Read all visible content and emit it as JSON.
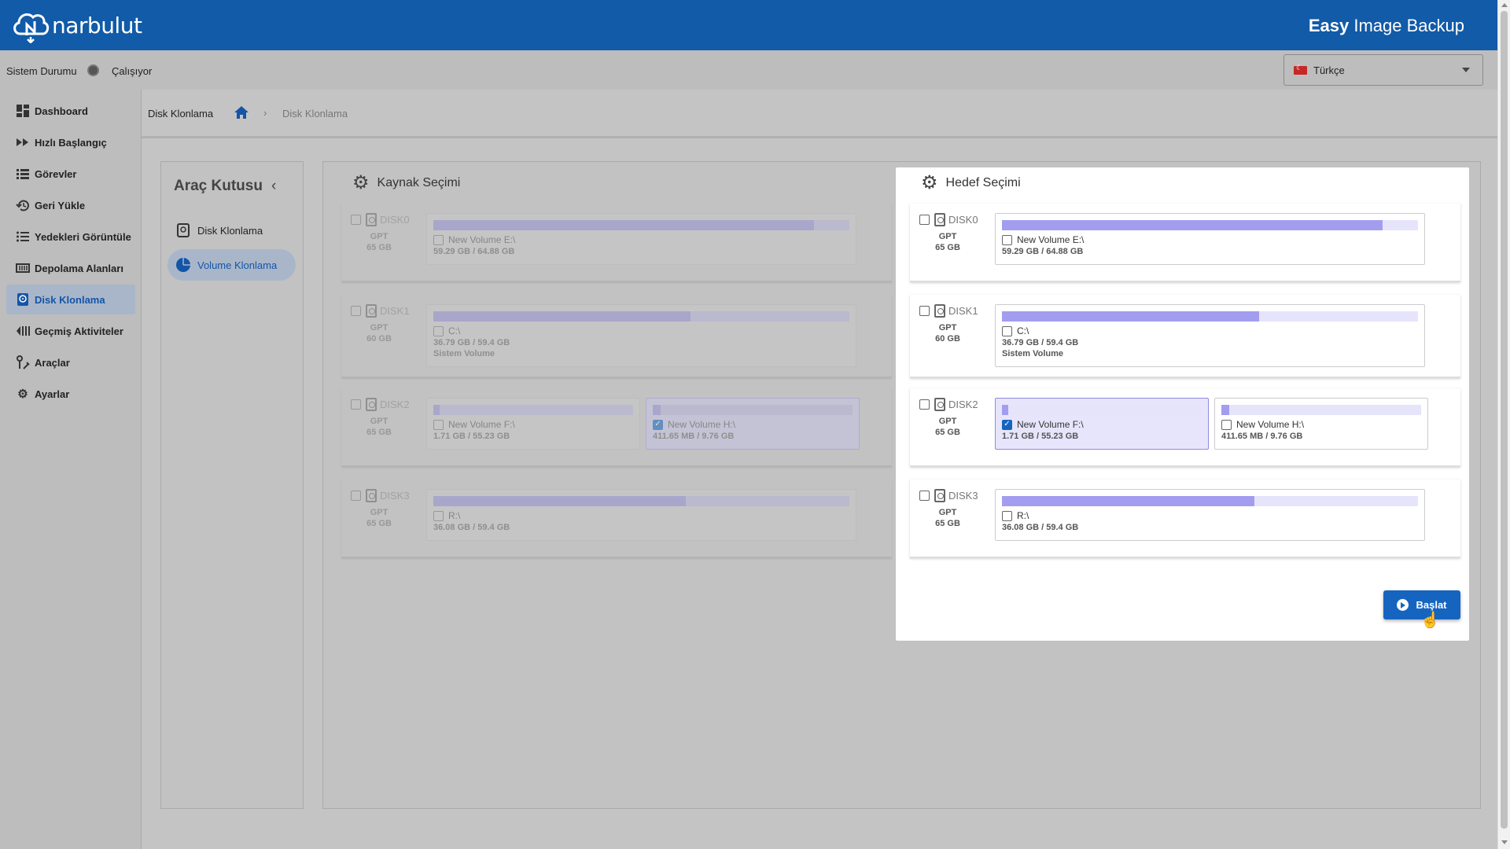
{
  "header": {
    "logo_text": "narbulut",
    "app_title_bold": "Easy",
    "app_title_rest": " Image Backup"
  },
  "status": {
    "label": "Sistem Durumu",
    "value": "Çalışıyor"
  },
  "language": {
    "selected": "Türkçe"
  },
  "sidebar": {
    "items": [
      {
        "label": "Dashboard",
        "icon": "dashboard-icon"
      },
      {
        "label": "Hızlı Başlangıç",
        "icon": "fast-forward-icon"
      },
      {
        "label": "Görevler",
        "icon": "list-icon"
      },
      {
        "label": "Geri Yükle",
        "icon": "restore-icon"
      },
      {
        "label": "Yedekleri Görüntüle",
        "icon": "view-list-icon"
      },
      {
        "label": "Depolama Alanları",
        "icon": "storage-icon"
      },
      {
        "label": "Disk Klonlama",
        "icon": "disk-clone-icon",
        "active": true
      },
      {
        "label": "Geçmiş Aktiviteler",
        "icon": "history-icon"
      },
      {
        "label": "Araçlar",
        "icon": "tools-icon"
      },
      {
        "label": "Ayarlar",
        "icon": "gear-icon"
      }
    ]
  },
  "breadcrumb": {
    "title": "Disk Klonlama",
    "separator": "›",
    "current": "Disk Klonlama"
  },
  "toolbox": {
    "title": "Araç Kutusu",
    "collapse": "‹",
    "items": [
      {
        "label": "Disk Klonlama"
      },
      {
        "label": "Volume Klonlama",
        "active": true
      }
    ]
  },
  "source": {
    "title": "Kaynak Seçimi",
    "disks": [
      {
        "name": "DISK0",
        "type": "GPT",
        "size": "65 GB",
        "volumes": [
          {
            "label": "New Volume E:\\",
            "size": "59.29 GB / 64.88 GB",
            "used": 0.914,
            "checked": false
          }
        ]
      },
      {
        "name": "DISK1",
        "type": "GPT",
        "size": "60 GB",
        "volumes": [
          {
            "label": "C:\\",
            "size": "36.79 GB / 59.4 GB",
            "extra": "Sistem Volume",
            "used": 0.619,
            "checked": false
          }
        ]
      },
      {
        "name": "DISK2",
        "type": "GPT",
        "size": "65 GB",
        "volumes": [
          {
            "label": "New Volume F:\\",
            "size": "1.71 GB / 55.23 GB",
            "used": 0.031,
            "checked": false
          },
          {
            "label": "New Volume H:\\",
            "size": "411.65 MB / 9.76 GB",
            "used": 0.041,
            "checked": true,
            "selected": true
          }
        ]
      },
      {
        "name": "DISK3",
        "type": "GPT",
        "size": "65 GB",
        "volumes": [
          {
            "label": "R:\\",
            "size": "36.08 GB / 59.4 GB",
            "used": 0.607,
            "checked": false
          }
        ]
      }
    ]
  },
  "target": {
    "title": "Hedef Seçimi",
    "disks": [
      {
        "name": "DISK0",
        "type": "GPT",
        "size": "65 GB",
        "volumes": [
          {
            "label": "New Volume E:\\",
            "size": "59.29 GB / 64.88 GB",
            "used": 0.914,
            "checked": false
          }
        ]
      },
      {
        "name": "DISK1",
        "type": "GPT",
        "size": "60 GB",
        "volumes": [
          {
            "label": "C:\\",
            "size": "36.79 GB / 59.4 GB",
            "extra": "Sistem Volume",
            "used": 0.619,
            "checked": false
          }
        ]
      },
      {
        "name": "DISK2",
        "type": "GPT",
        "size": "65 GB",
        "volumes": [
          {
            "label": "New Volume F:\\",
            "size": "1.71 GB / 55.23 GB",
            "used": 0.031,
            "checked": true,
            "selected": true
          },
          {
            "label": "New Volume H:\\",
            "size": "411.65 MB / 9.76 GB",
            "used": 0.041,
            "checked": false
          }
        ]
      },
      {
        "name": "DISK3",
        "type": "GPT",
        "size": "65 GB",
        "volumes": [
          {
            "label": "R:\\",
            "size": "36.08 GB / 59.4 GB",
            "used": 0.607,
            "checked": false
          }
        ]
      }
    ],
    "start_label": "Başlat"
  }
}
